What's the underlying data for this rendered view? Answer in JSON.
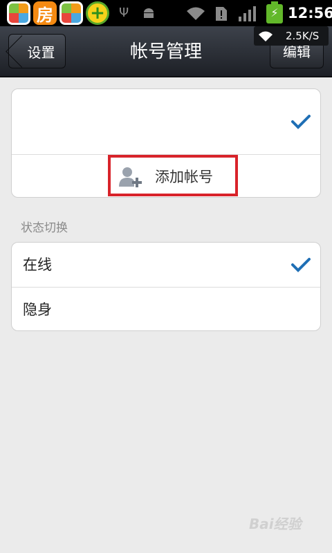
{
  "status_bar": {
    "apps": [
      "pinwheel-app-icon",
      "fang-app-icon",
      "pinwheel-app-icon",
      "plus-app-icon"
    ],
    "fang_label": "房",
    "plus_label": "+",
    "battery_symbol": "⚡",
    "time": "12:56"
  },
  "net_overlay": {
    "wifi_symbol": "◠",
    "speed": "2.5K/S"
  },
  "titlebar": {
    "back_label": "设置",
    "title": "帐号管理",
    "edit_label": "编辑"
  },
  "accounts": {
    "add_account_label": "添加帐号"
  },
  "status_section": {
    "heading": "状态切换",
    "options": [
      {
        "label": "在线",
        "selected": true
      },
      {
        "label": "隐身",
        "selected": false
      }
    ]
  },
  "watermark": "Bai经验",
  "colors": {
    "accent_check": "#1f6fb5",
    "highlight_box": "#d8232a"
  }
}
